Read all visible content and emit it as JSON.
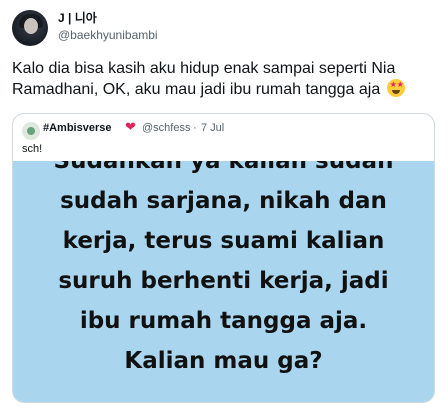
{
  "tweet": {
    "display_name": "J | 니아",
    "handle": "@baekhyunibambi",
    "text": "Kalo dia bisa kasih aku hidup enak sampai seperti Nia Ramadhani, OK, aku mau jadi ibu rumah tangga aja",
    "emoji": "star-struck-emoji"
  },
  "quote": {
    "name": "#Ambisverse",
    "heart": "❤",
    "handle": "@schfess",
    "separator": "·",
    "date": "7 Jul",
    "text": "sch!",
    "image": {
      "background": "#a9d6ee",
      "lines": [
        "sudah sarjana, nikah dan",
        "kerja, terus suami kalian",
        "suruh berhenti kerja, jadi",
        "ibu rumah tangga aja.",
        "Kalian mau ga?"
      ]
    }
  }
}
